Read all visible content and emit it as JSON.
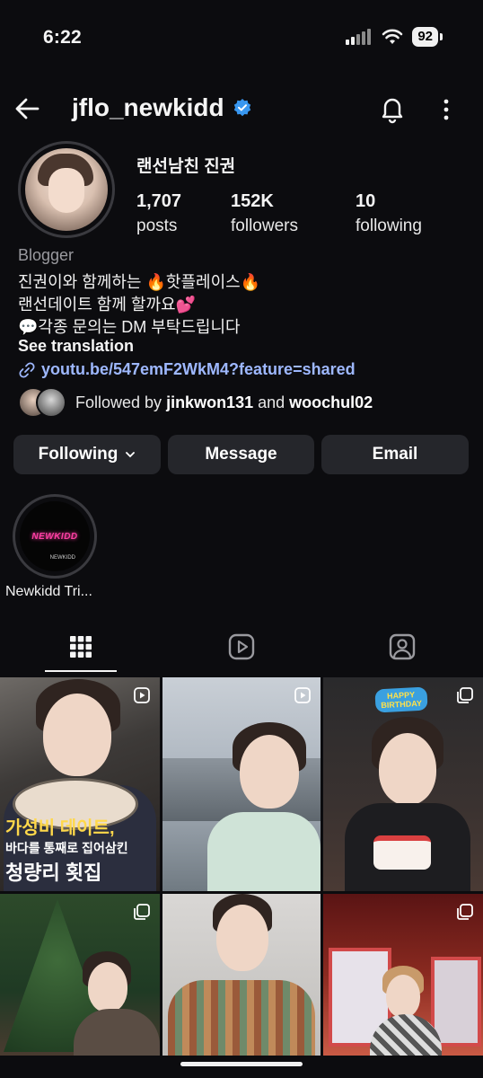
{
  "status_bar": {
    "time": "6:22",
    "battery": "92"
  },
  "header": {
    "username": "jflo_newkidd"
  },
  "profile": {
    "display_name": "랜선남친 진권",
    "stats": [
      {
        "value": "1,707",
        "label": "posts"
      },
      {
        "value": "152K",
        "label": "followers"
      },
      {
        "value": "10",
        "label": "following"
      }
    ],
    "category": "Blogger",
    "bio_lines": [
      "진권이와 함께하는 🔥핫플레이스🔥",
      "랜선데이트 함께 할까요💕",
      "💬각종 문의는 DM 부탁드립니다"
    ],
    "see_translation": "See translation",
    "link": "youtu.be/547emF2WkM4?feature=shared",
    "followed_by": {
      "prefix": "Followed by ",
      "user1": "jinkwon131",
      "and": " and ",
      "user2": "woochul02"
    }
  },
  "actions": {
    "following": "Following",
    "message": "Message",
    "email": "Email"
  },
  "highlight": {
    "label": "Newkidd Tri...",
    "logo_text": "NEWKIDD",
    "small_text": "NEWKIDD"
  },
  "tabs": [
    "posts-grid",
    "reels",
    "tagged"
  ],
  "posts": {
    "t1_caption": [
      "가성비 데이트,",
      "바다를 통째로 집어삼킨",
      "청량리 횟집"
    ],
    "t3_banner": [
      "HAPPY",
      "BIRTHDAY"
    ]
  },
  "colors": {
    "background": "#0c0c0f",
    "button": "#25262b",
    "link": "#9eb8ff",
    "verified": "#3897f0"
  }
}
